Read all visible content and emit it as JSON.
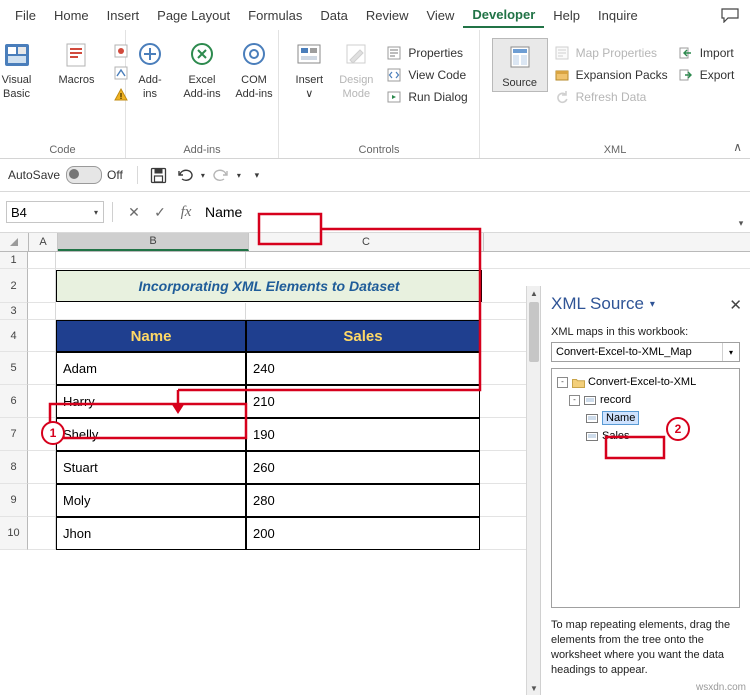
{
  "ribbon": {
    "tabs": [
      {
        "label": "File",
        "active": false
      },
      {
        "label": "Home",
        "active": false
      },
      {
        "label": "Insert",
        "active": false
      },
      {
        "label": "Page Layout",
        "active": false
      },
      {
        "label": "Formulas",
        "active": false
      },
      {
        "label": "Data",
        "active": false
      },
      {
        "label": "Review",
        "active": false
      },
      {
        "label": "View",
        "active": false
      },
      {
        "label": "Developer",
        "active": true
      },
      {
        "label": "Help",
        "active": false
      },
      {
        "label": "Inquire",
        "active": false
      }
    ],
    "groups": [
      {
        "name": "Code",
        "big": [
          {
            "label": "Visual\nBasic",
            "l1": "Visual",
            "l2": "Basic"
          },
          {
            "label": "Macros",
            "l1": "Macros",
            "l2": ""
          }
        ],
        "small": [
          {
            "label": "Record Macro"
          },
          {
            "label": "Use Relative References"
          },
          {
            "label": "Macro Security"
          }
        ]
      },
      {
        "name": "Add-ins",
        "big": [
          {
            "l1": "Add-",
            "l2": "ins"
          },
          {
            "l1": "Excel",
            "l2": "Add-ins"
          },
          {
            "l1": "COM",
            "l2": "Add-ins"
          }
        ]
      },
      {
        "name": "Controls",
        "big": [
          {
            "l1": "Insert",
            "l2": "∨"
          },
          {
            "l1": "Design",
            "l2": "Mode"
          }
        ],
        "small": [
          {
            "label": "Properties"
          },
          {
            "label": "View Code"
          },
          {
            "label": "Run Dialog"
          }
        ]
      },
      {
        "name": "XML",
        "big": [
          {
            "l1": "Source",
            "l2": ""
          }
        ],
        "small": [
          {
            "label": "Map Properties",
            "disabled": true
          },
          {
            "label": "Expansion Packs",
            "disabled": false
          },
          {
            "label": "Refresh Data",
            "disabled": true
          },
          {
            "label": "Import",
            "disabled": false
          },
          {
            "label": "Export",
            "disabled": false
          }
        ]
      }
    ],
    "collapse": "∧"
  },
  "quickbar": {
    "autosave_label": "AutoSave",
    "toggle_state": "Off",
    "save_icon": "save-icon",
    "undo_icon": "undo-icon",
    "redo_icon": "redo-icon",
    "more_icon": "more-icon"
  },
  "formula_bar": {
    "name_box": "B4",
    "cancel": "✕",
    "enter": "✓",
    "fx": "fx",
    "content": "Name"
  },
  "sheet": {
    "columns": [
      "A",
      "B",
      "C"
    ],
    "selected_column": "B",
    "rows": [
      "1",
      "2",
      "3",
      "4",
      "5",
      "6",
      "7",
      "8",
      "9",
      "10"
    ],
    "banner_text": "Incorporating XML Elements to Dataset",
    "headers": [
      "Name",
      "Sales"
    ],
    "data": [
      {
        "name": "Adam",
        "sales": "240"
      },
      {
        "name": "Harry",
        "sales": "210"
      },
      {
        "name": "Shelly",
        "sales": "190"
      },
      {
        "name": "Stuart",
        "sales": "260"
      },
      {
        "name": "Moly",
        "sales": "280"
      },
      {
        "name": "Jhon",
        "sales": "200"
      }
    ]
  },
  "xml_pane": {
    "title": "XML Source",
    "close": "✕",
    "maps_label": "XML maps in this workbook:",
    "selected_map": "Convert-Excel-to-XML_Map",
    "tree": [
      {
        "label": "Convert-Excel-to-XML",
        "level": 0,
        "toggle": "-",
        "icon": "folder-icon",
        "selected": false
      },
      {
        "label": "record",
        "level": 1,
        "toggle": "-",
        "icon": "element-icon",
        "selected": false
      },
      {
        "label": "Name",
        "level": 2,
        "toggle": "",
        "icon": "element-icon",
        "selected": true
      },
      {
        "label": "Sales",
        "level": 2,
        "toggle": "",
        "icon": "element-icon",
        "selected": false
      }
    ],
    "hint": "To map repeating elements, drag the elements from the tree onto the worksheet where you want the data headings to appear."
  },
  "annotations": {
    "badge1": "1",
    "badge2": "2"
  },
  "watermark": "wsxdn.com",
  "colors": {
    "accent": "#217346",
    "annotation": "#d6001c",
    "header_bg": "#1f3f8f",
    "header_fg": "#ffd966",
    "banner_bg": "#e8f1df",
    "banner_fg": "#1f5c99"
  }
}
